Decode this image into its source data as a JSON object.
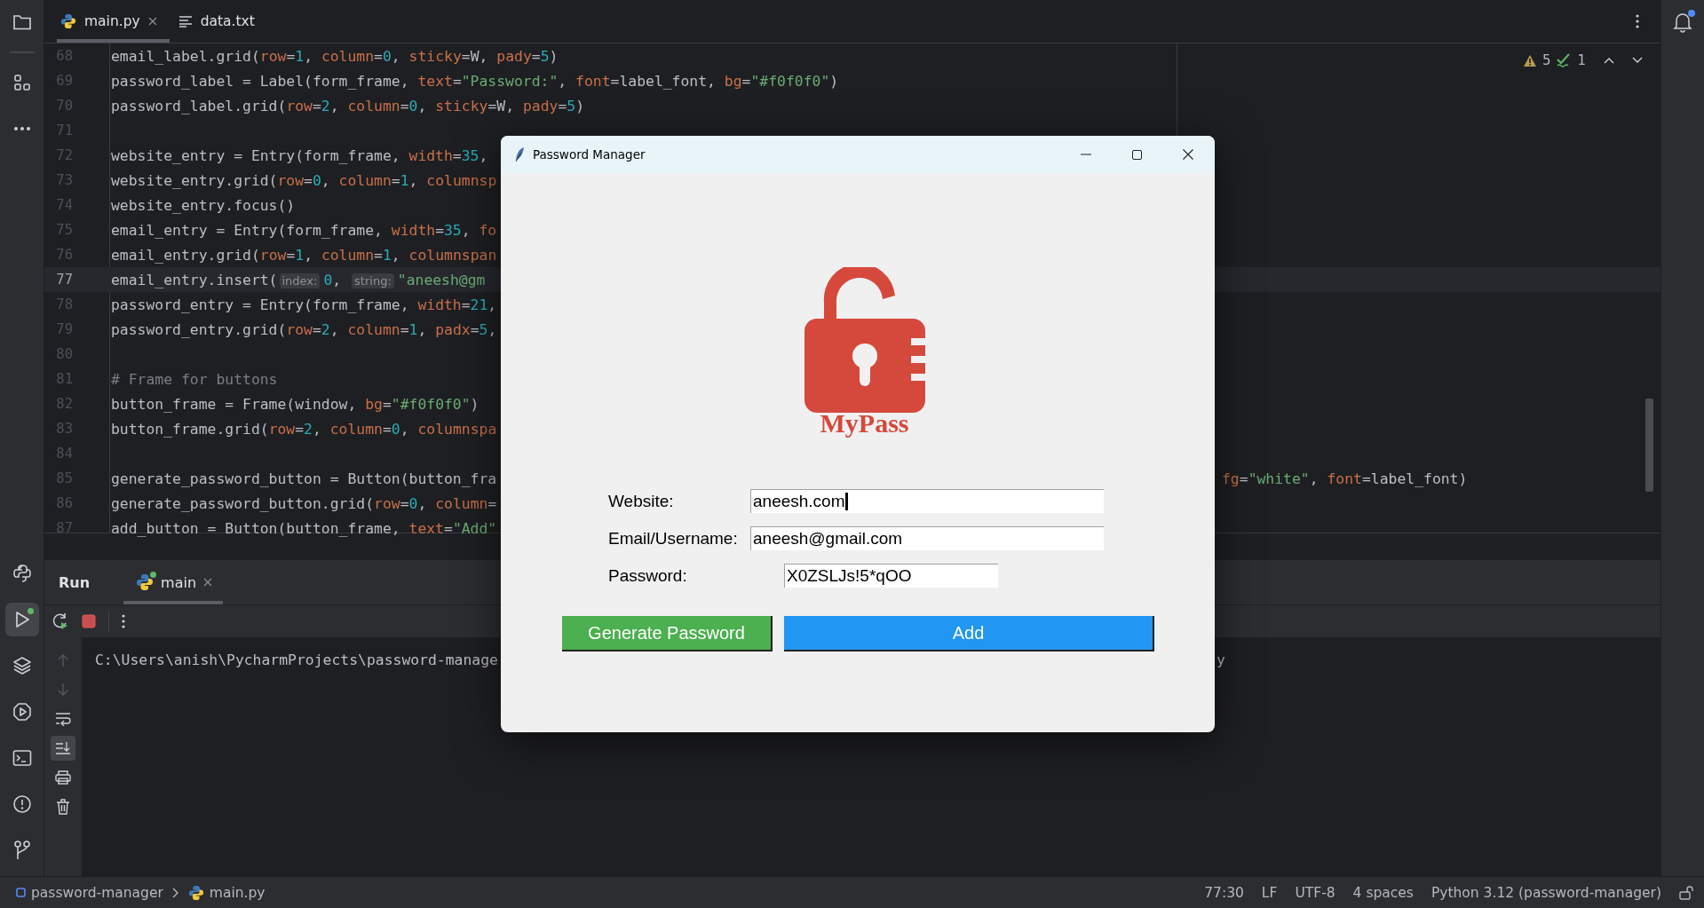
{
  "tool_windows": [
    {
      "kind": "project",
      "selected": false,
      "running": false
    },
    {
      "kind": "structure",
      "selected": false,
      "running": false
    },
    {
      "kind": "more",
      "selected": false,
      "running": false
    },
    {
      "kind": "python-console",
      "selected": false,
      "running": false
    },
    {
      "kind": "run",
      "selected": true,
      "running": true
    },
    {
      "kind": "layers",
      "selected": false,
      "running": false
    },
    {
      "kind": "services",
      "selected": false,
      "running": false
    },
    {
      "kind": "terminal",
      "selected": false,
      "running": false
    },
    {
      "kind": "problems",
      "selected": false,
      "running": false
    },
    {
      "kind": "git",
      "selected": false,
      "running": false
    }
  ],
  "notifications": {
    "unread": true
  },
  "editor_tabs": [
    {
      "label": "main.py",
      "kind": "python",
      "selected": true,
      "closable": true
    },
    {
      "label": "data.txt",
      "kind": "text",
      "selected": false,
      "closable": false
    }
  ],
  "inspections": {
    "warnings": "5",
    "weak_warnings": "1"
  },
  "editor_lines": [
    {
      "number": "68",
      "current": false,
      "code": [
        {
          "kind": "plain",
          "text": "email_label.grid("
        },
        {
          "kind": "arg",
          "text": "row"
        },
        {
          "kind": "plain",
          "text": "="
        },
        {
          "kind": "num",
          "text": "1"
        },
        {
          "kind": "plain",
          "text": ", "
        },
        {
          "kind": "arg",
          "text": "column"
        },
        {
          "kind": "plain",
          "text": "="
        },
        {
          "kind": "num",
          "text": "0"
        },
        {
          "kind": "plain",
          "text": ", "
        },
        {
          "kind": "arg",
          "text": "sticky"
        },
        {
          "kind": "plain",
          "text": "=W, "
        },
        {
          "kind": "arg",
          "text": "pady"
        },
        {
          "kind": "plain",
          "text": "="
        },
        {
          "kind": "num",
          "text": "5"
        },
        {
          "kind": "plain",
          "text": ")"
        }
      ]
    },
    {
      "number": "69",
      "current": false,
      "code": [
        {
          "kind": "plain",
          "text": "password_label = Label(form_frame, "
        },
        {
          "kind": "arg",
          "text": "text"
        },
        {
          "kind": "plain",
          "text": "="
        },
        {
          "kind": "str",
          "text": "\"Password:\""
        },
        {
          "kind": "plain",
          "text": ", "
        },
        {
          "kind": "arg",
          "text": "font"
        },
        {
          "kind": "plain",
          "text": "=label_font, "
        },
        {
          "kind": "arg",
          "text": "bg"
        },
        {
          "kind": "plain",
          "text": "="
        },
        {
          "kind": "str",
          "text": "\"#f0f0f0\""
        },
        {
          "kind": "plain",
          "text": ")"
        }
      ]
    },
    {
      "number": "70",
      "current": false,
      "code": [
        {
          "kind": "plain",
          "text": "password_label.grid("
        },
        {
          "kind": "arg",
          "text": "row"
        },
        {
          "kind": "plain",
          "text": "="
        },
        {
          "kind": "num",
          "text": "2"
        },
        {
          "kind": "plain",
          "text": ", "
        },
        {
          "kind": "arg",
          "text": "column"
        },
        {
          "kind": "plain",
          "text": "="
        },
        {
          "kind": "num",
          "text": "0"
        },
        {
          "kind": "plain",
          "text": ", "
        },
        {
          "kind": "arg",
          "text": "sticky"
        },
        {
          "kind": "plain",
          "text": "=W, "
        },
        {
          "kind": "arg",
          "text": "pady"
        },
        {
          "kind": "plain",
          "text": "="
        },
        {
          "kind": "num",
          "text": "5"
        },
        {
          "kind": "plain",
          "text": ")"
        }
      ]
    },
    {
      "number": "71",
      "current": false
    },
    {
      "number": "72",
      "current": false,
      "code": [
        {
          "kind": "plain",
          "text": "website_entry = Entry(form_frame, "
        },
        {
          "kind": "arg",
          "text": "width"
        },
        {
          "kind": "plain",
          "text": "="
        },
        {
          "kind": "num",
          "text": "35"
        },
        {
          "kind": "plain",
          "text": ","
        }
      ]
    },
    {
      "number": "73",
      "current": false,
      "code": [
        {
          "kind": "plain",
          "text": "website_entry.grid("
        },
        {
          "kind": "arg",
          "text": "row"
        },
        {
          "kind": "plain",
          "text": "="
        },
        {
          "kind": "num",
          "text": "0"
        },
        {
          "kind": "plain",
          "text": ", "
        },
        {
          "kind": "arg",
          "text": "column"
        },
        {
          "kind": "plain",
          "text": "="
        },
        {
          "kind": "num",
          "text": "1"
        },
        {
          "kind": "plain",
          "text": ", "
        },
        {
          "kind": "arg",
          "text": "columnsp"
        }
      ]
    },
    {
      "number": "74",
      "current": false,
      "code": [
        {
          "kind": "plain",
          "text": "website_entry.focus()"
        }
      ]
    },
    {
      "number": "75",
      "current": false,
      "code": [
        {
          "kind": "plain",
          "text": "email_entry = Entry(form_frame, "
        },
        {
          "kind": "arg",
          "text": "width"
        },
        {
          "kind": "plain",
          "text": "="
        },
        {
          "kind": "num",
          "text": "35"
        },
        {
          "kind": "plain",
          "text": ", "
        },
        {
          "kind": "arg",
          "text": "fo"
        }
      ]
    },
    {
      "number": "76",
      "current": false,
      "code": [
        {
          "kind": "plain",
          "text": "email_entry.grid("
        },
        {
          "kind": "arg",
          "text": "row"
        },
        {
          "kind": "plain",
          "text": "="
        },
        {
          "kind": "num",
          "text": "1"
        },
        {
          "kind": "plain",
          "text": ", "
        },
        {
          "kind": "arg",
          "text": "column"
        },
        {
          "kind": "plain",
          "text": "="
        },
        {
          "kind": "num",
          "text": "1"
        },
        {
          "kind": "plain",
          "text": ", "
        },
        {
          "kind": "arg",
          "text": "columnspan"
        }
      ]
    },
    {
      "number": "77",
      "current": true,
      "code": [
        {
          "kind": "plain",
          "text": "email_entry.insert("
        },
        {
          "kind": "hint",
          "text": "index:"
        },
        {
          "kind": "num",
          "text": "0"
        },
        {
          "kind": "plain",
          "text": ", "
        },
        {
          "kind": "hint",
          "text": "string:"
        },
        {
          "kind": "str",
          "text": "\"aneesh@gm"
        }
      ]
    },
    {
      "number": "78",
      "current": false,
      "code": [
        {
          "kind": "plain",
          "text": "password_entry = Entry(form_frame, "
        },
        {
          "kind": "arg",
          "text": "width"
        },
        {
          "kind": "plain",
          "text": "="
        },
        {
          "kind": "num",
          "text": "21"
        },
        {
          "kind": "plain",
          "text": ","
        }
      ]
    },
    {
      "number": "79",
      "current": false,
      "code": [
        {
          "kind": "plain",
          "text": "password_entry.grid("
        },
        {
          "kind": "arg",
          "text": "row"
        },
        {
          "kind": "plain",
          "text": "="
        },
        {
          "kind": "num",
          "text": "2"
        },
        {
          "kind": "plain",
          "text": ", "
        },
        {
          "kind": "arg",
          "text": "column"
        },
        {
          "kind": "plain",
          "text": "="
        },
        {
          "kind": "num",
          "text": "1"
        },
        {
          "kind": "plain",
          "text": ", "
        },
        {
          "kind": "arg",
          "text": "padx"
        },
        {
          "kind": "plain",
          "text": "="
        },
        {
          "kind": "num",
          "text": "5"
        },
        {
          "kind": "plain",
          "text": ","
        }
      ]
    },
    {
      "number": "80",
      "current": false
    },
    {
      "number": "81",
      "current": false,
      "code": [
        {
          "kind": "comment",
          "text": "# Frame for buttons"
        }
      ]
    },
    {
      "number": "82",
      "current": false,
      "code": [
        {
          "kind": "plain",
          "text": "button_frame = Frame(window, "
        },
        {
          "kind": "arg",
          "text": "bg"
        },
        {
          "kind": "plain",
          "text": "="
        },
        {
          "kind": "str",
          "text": "\"#f0f0f0\""
        },
        {
          "kind": "plain",
          "text": ")"
        }
      ]
    },
    {
      "number": "83",
      "current": false,
      "code": [
        {
          "kind": "plain",
          "text": "button_frame.grid("
        },
        {
          "kind": "arg",
          "text": "row"
        },
        {
          "kind": "plain",
          "text": "="
        },
        {
          "kind": "num",
          "text": "2"
        },
        {
          "kind": "plain",
          "text": ", "
        },
        {
          "kind": "arg",
          "text": "column"
        },
        {
          "kind": "plain",
          "text": "="
        },
        {
          "kind": "num",
          "text": "0"
        },
        {
          "kind": "plain",
          "text": ", "
        },
        {
          "kind": "arg",
          "text": "columnspa"
        }
      ]
    },
    {
      "number": "84",
      "current": false
    },
    {
      "number": "85",
      "current": false,
      "code": [
        {
          "kind": "plain",
          "text": "generate_password_button = Button(button_fra"
        }
      ],
      "right_code": [
        {
          "kind": "arg",
          "text": "fg"
        },
        {
          "kind": "plain",
          "text": "="
        },
        {
          "kind": "str",
          "text": "\"white\""
        },
        {
          "kind": "plain",
          "text": ", "
        },
        {
          "kind": "arg",
          "text": "font"
        },
        {
          "kind": "plain",
          "text": "=label_font)"
        }
      ]
    },
    {
      "number": "86",
      "current": false,
      "code": [
        {
          "kind": "plain",
          "text": "generate_password_button.grid("
        },
        {
          "kind": "arg",
          "text": "row"
        },
        {
          "kind": "plain",
          "text": "="
        },
        {
          "kind": "num",
          "text": "0"
        },
        {
          "kind": "plain",
          "text": ", "
        },
        {
          "kind": "arg",
          "text": "column"
        },
        {
          "kind": "plain",
          "text": "="
        }
      ]
    },
    {
      "number": "87",
      "current": false,
      "code": [
        {
          "kind": "plain",
          "text": "add_button = Button(button_frame, "
        },
        {
          "kind": "arg",
          "text": "text"
        },
        {
          "kind": "plain",
          "text": "="
        },
        {
          "kind": "str",
          "text": "\"Add\""
        }
      ]
    }
  ],
  "run_panel": {
    "title": "Run",
    "tabs": [
      {
        "label": "main",
        "selected": true,
        "running": true
      }
    ],
    "side_tools": [
      {
        "kind": "up",
        "selected": false,
        "disabled": true
      },
      {
        "kind": "down",
        "selected": false,
        "disabled": true
      },
      {
        "kind": "wrap",
        "selected": false,
        "disabled": false
      },
      {
        "kind": "scroll-end",
        "selected": true,
        "disabled": false
      },
      {
        "kind": "print",
        "selected": false,
        "disabled": false
      },
      {
        "kind": "trash",
        "selected": false,
        "disabled": false
      }
    ],
    "output": [
      {
        "text": "C:\\Users\\anish\\PycharmProjects\\password-manage",
        "right_text": "y"
      }
    ]
  },
  "status_bar": {
    "breadcrumbs": [
      {
        "label": "password-manager",
        "kind": "module"
      },
      {
        "label": "main.py",
        "kind": "python"
      }
    ],
    "items": [
      "77:30",
      "LF",
      "UTF-8",
      "4 spaces",
      "Python 3.12 (password-manager)"
    ]
  },
  "dialog": {
    "title": "Password Manager",
    "logo_text": "MyPass",
    "fields": [
      {
        "label": "Website:",
        "value": "aneesh.com",
        "focused": true,
        "kind": "wide"
      },
      {
        "label": "Email/Username:",
        "value": "aneesh@gmail.com",
        "focused": false,
        "kind": "wide"
      },
      {
        "label": "Password:",
        "value": "X0ZSLJs!5*qOO",
        "focused": false,
        "kind": "short"
      }
    ],
    "buttons": [
      {
        "label": "Generate Password",
        "color": "#4caf50"
      },
      {
        "label": "Add",
        "color": "#2196f3"
      }
    ]
  }
}
